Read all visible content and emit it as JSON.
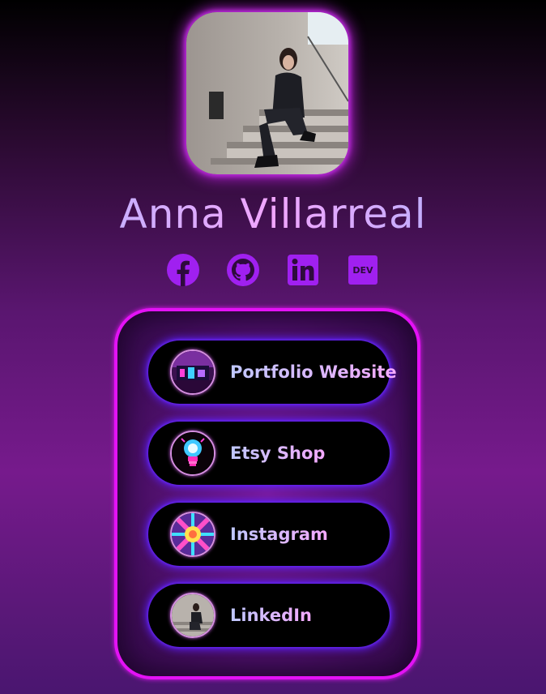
{
  "profile": {
    "name": "Anna Villarreal",
    "avatar_alt": "profile-photo"
  },
  "socials": [
    {
      "name": "facebook-icon"
    },
    {
      "name": "github-icon"
    },
    {
      "name": "linkedin-icon"
    },
    {
      "name": "dev-icon",
      "text": "DEV"
    }
  ],
  "links": [
    {
      "label": "Portfolio Website",
      "icon": "portfolio-thumbnail"
    },
    {
      "label": "Etsy Shop",
      "icon": "lightbulb-thumbnail"
    },
    {
      "label": "Instagram",
      "icon": "instagram-thumbnail"
    },
    {
      "label": "LinkedIn",
      "icon": "linkedin-thumbnail"
    }
  ],
  "colors": {
    "accent": "#a020f0",
    "panel_border": "#e312f5",
    "button_bg": "#000000",
    "button_glow": "#5a1cf0"
  }
}
